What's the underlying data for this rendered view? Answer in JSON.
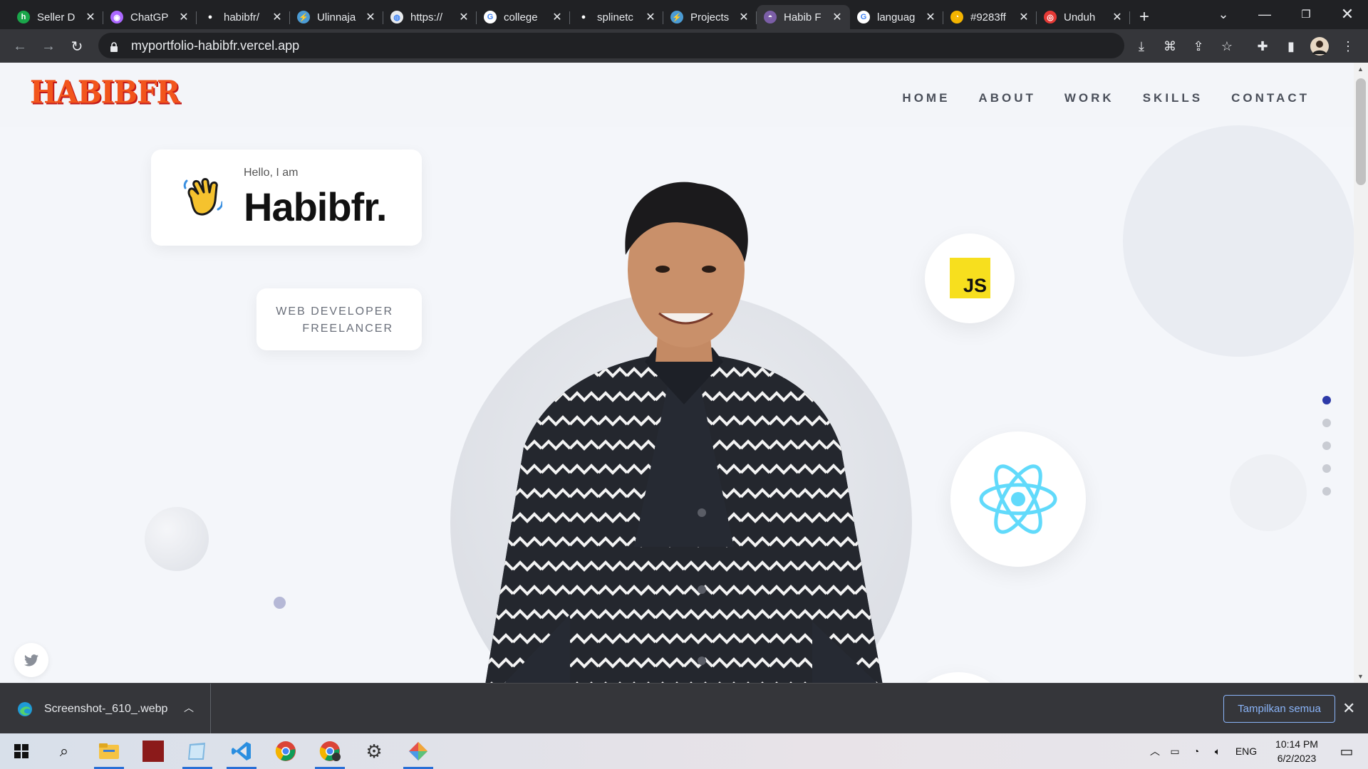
{
  "browser": {
    "tabs": [
      {
        "title": "Seller D",
        "favicon_color": "#1aa64a",
        "glyph": "h"
      },
      {
        "title": "ChatGP",
        "favicon_color": "#ab68ff",
        "glyph": "◉"
      },
      {
        "title": "habibfr/",
        "favicon_color": "#202124",
        "glyph": "●"
      },
      {
        "title": "Ulinnaja",
        "favicon_color": "#4b9bd4",
        "glyph": "⚡"
      },
      {
        "title": "https://",
        "favicon_color": "#e8eaed",
        "glyph": "◍"
      },
      {
        "title": "college",
        "favicon_color": "#ffffff",
        "glyph": "G"
      },
      {
        "title": "splinetc",
        "favicon_color": "#202124",
        "glyph": "●"
      },
      {
        "title": "Projects",
        "favicon_color": "#4b9bd4",
        "glyph": "⚡"
      },
      {
        "title": "Habib F",
        "favicon_color": "#7b5ea7",
        "glyph": "◓",
        "active": true
      },
      {
        "title": "languag",
        "favicon_color": "#ffffff",
        "glyph": "G"
      },
      {
        "title": "#9283ff",
        "favicon_color": "#f4b400",
        "glyph": "◔"
      },
      {
        "title": "Unduh",
        "favicon_color": "#e53935",
        "glyph": "◎"
      }
    ],
    "url": "myportfolio-habibfr.vercel.app"
  },
  "page": {
    "logo": "HABIBFR",
    "nav": [
      "HOME",
      "ABOUT",
      "WORK",
      "SKILLS",
      "CONTACT"
    ],
    "greeting": "Hello, I am",
    "name": "Habibfr.",
    "roles": [
      "WEB DEVELOPER",
      "FREELANCER"
    ],
    "skills": [
      "JS",
      "React"
    ],
    "js_badge_color": "#f7df1e",
    "react_color": "#61dafb",
    "section_dots": {
      "count": 5,
      "active_index": 0,
      "active_color": "#2d3aa8"
    },
    "social": "twitter-icon"
  },
  "downloads": {
    "file": "Screenshot-_610_.webp",
    "show_all": "Tampilkan semua"
  },
  "taskbar": {
    "language": "ENG",
    "time": "10:14 PM",
    "date": "6/2/2023"
  }
}
